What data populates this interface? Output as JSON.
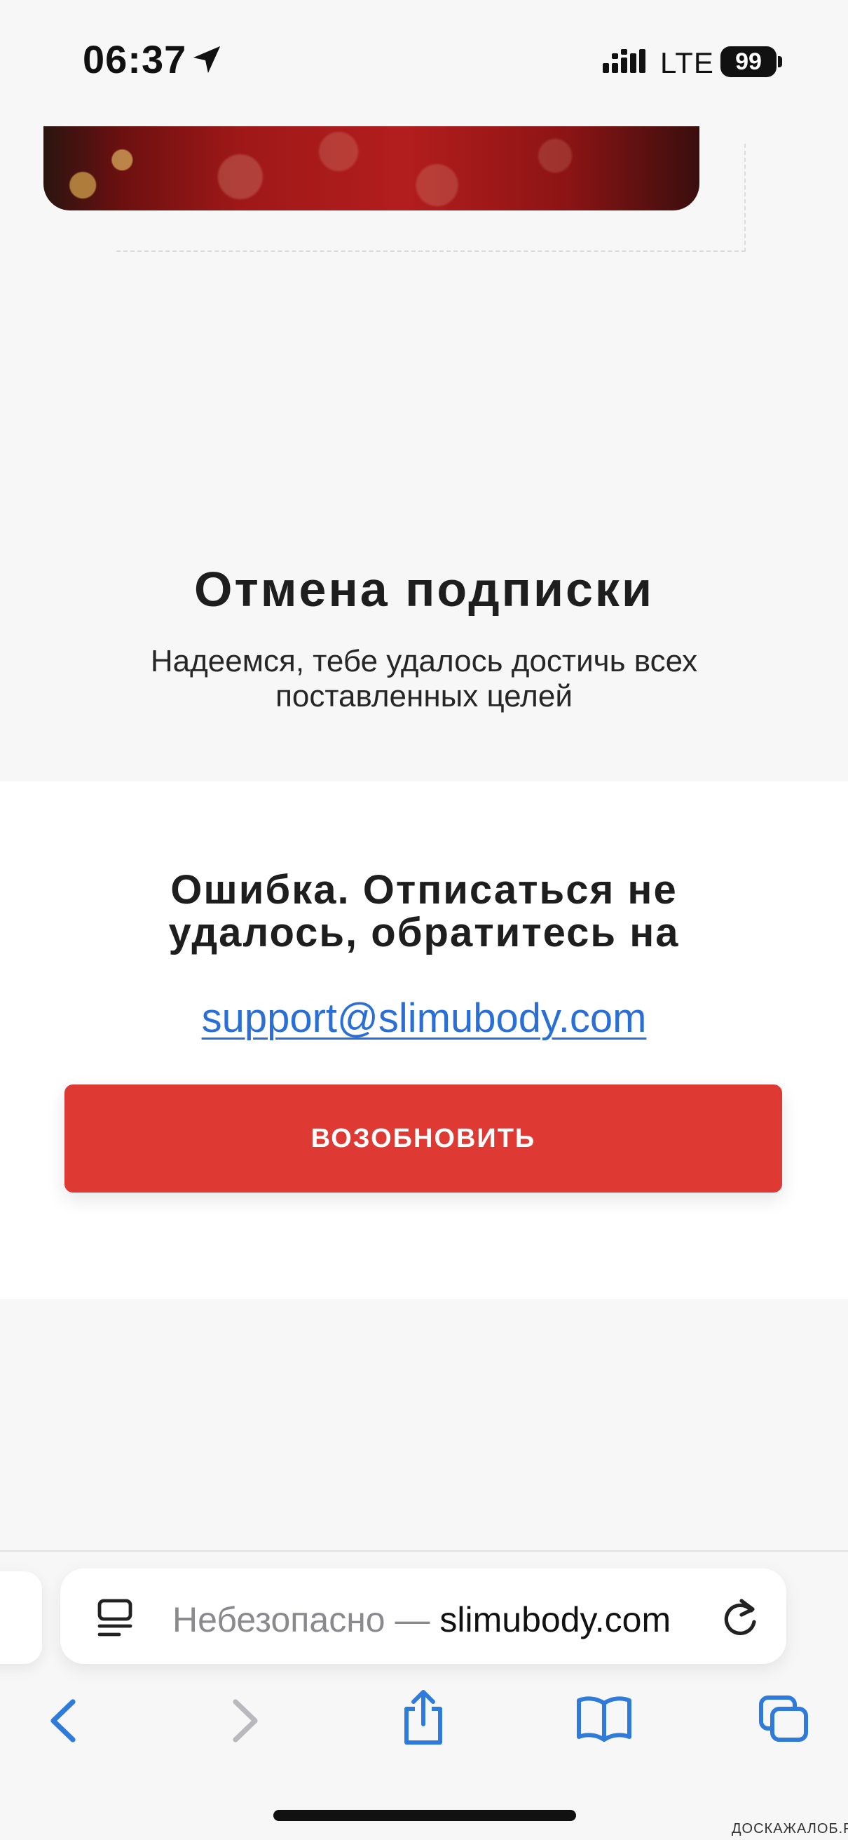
{
  "status_bar": {
    "time": "06:37",
    "network": "LTE",
    "battery": "99"
  },
  "page": {
    "title": "Отмена подписки",
    "subtitle": "Надеемся, тебе удалось достичь всех поставленных целей",
    "error_message": "Ошибка. Отписаться не удалось, обратитесь на",
    "support_email": "support@slimubody.com",
    "renew_button": "ВОЗОБНОВИТЬ"
  },
  "browser": {
    "address_prefix": "Небезопасно — ",
    "address_domain": "slimubody.com"
  },
  "watermark": "ДОСКАЖАЛОБ.РФ",
  "colors": {
    "accent_button": "#de3932",
    "link": "#2a6fd6",
    "browser_tint": "#2f7bdc"
  },
  "icons": [
    "location-arrow-icon",
    "signal-icon",
    "reader-mode-icon",
    "reload-icon",
    "back-icon",
    "forward-icon",
    "share-icon",
    "bookmarks-icon",
    "tabs-icon"
  ]
}
